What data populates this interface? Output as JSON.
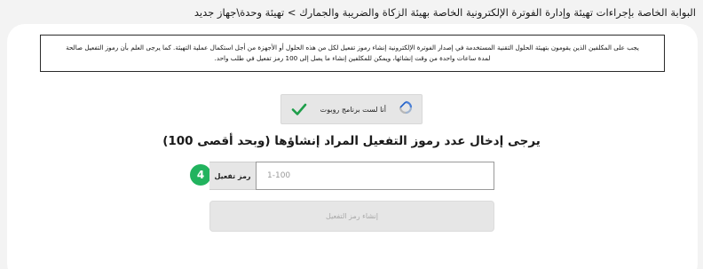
{
  "breadcrumb": {
    "text": "البوابة الخاصة بإجراءات تهيئة وإدارة الفوترة الإلكترونية الخاصة بهيئة الزكاة والضريبة والجمارك > تهيئة وحدة\\جهاز جديد"
  },
  "notice": {
    "line1": "يجب على المكلفين الذين يقومون بتهيئة الحلول التقنية المستخدمة في إصدار الفوترة الإلكترونية إنشاء رموز تفعيل لكل من هذه الحلول أو الأجهزة من أجل استكمال عملية التهيئة. كما يرجى العلم بأن رموز التفعيل صالحة",
    "line2": "لمدة ساعات واحدة من وقت إنشائها، ويمكن للمكلفين إنشاء ما يصل إلى 100 رمز تفعيل في طلب واحد."
  },
  "captcha": {
    "label": "أنا لست برنامج روبوت",
    "checked": true,
    "check_color": "#1e9e4a",
    "icon": "recaptcha-logo-icon"
  },
  "heading": "يرجى إدخال عدد رموز التفعيل المراد إنشاؤها (وبحد أقصى 100)",
  "step": {
    "number": "4",
    "color": "#22b35e"
  },
  "input": {
    "label": "رمز تفعيل",
    "value": "",
    "placeholder": "1-100"
  },
  "submit_button": {
    "label": "إنشاء رمز التفعيل",
    "disabled": true
  }
}
